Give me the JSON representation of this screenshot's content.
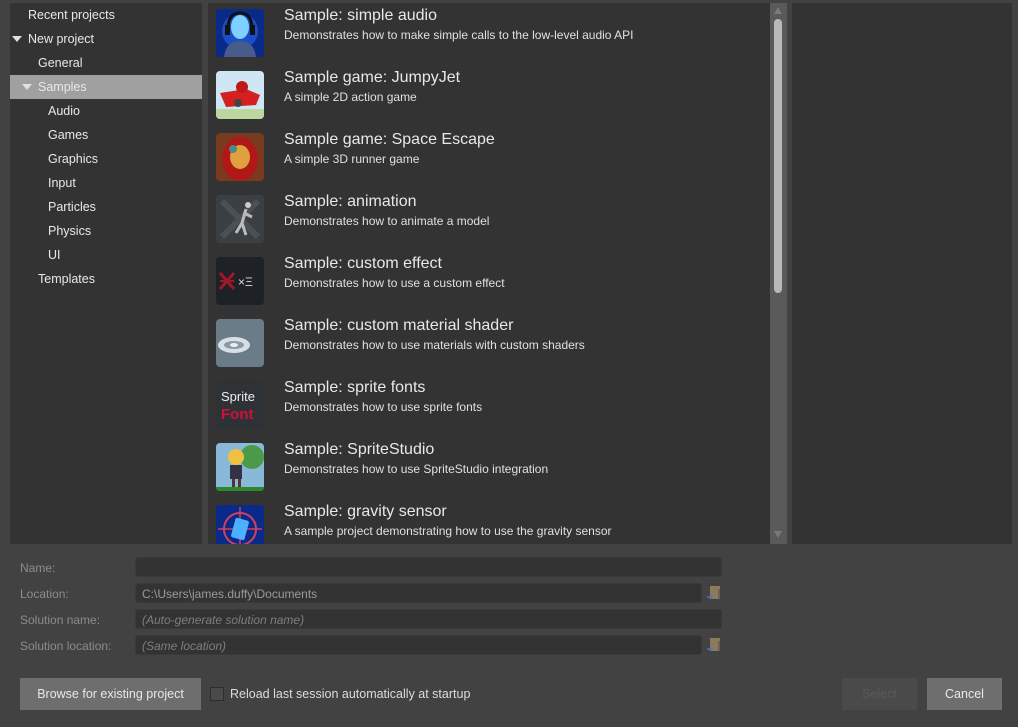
{
  "tree": {
    "items": [
      {
        "label": "Recent projects",
        "level": 0,
        "expandable": false,
        "selected": false
      },
      {
        "label": "New project",
        "level": 0,
        "expandable": true,
        "selected": false
      },
      {
        "label": "General",
        "level": 1,
        "expandable": false,
        "selected": false
      },
      {
        "label": "Samples",
        "level": 1,
        "expandable": true,
        "selected": true
      },
      {
        "label": "Audio",
        "level": 2,
        "expandable": false,
        "selected": false
      },
      {
        "label": "Games",
        "level": 2,
        "expandable": false,
        "selected": false
      },
      {
        "label": "Graphics",
        "level": 2,
        "expandable": false,
        "selected": false
      },
      {
        "label": "Input",
        "level": 2,
        "expandable": false,
        "selected": false
      },
      {
        "label": "Particles",
        "level": 2,
        "expandable": false,
        "selected": false
      },
      {
        "label": "Physics",
        "level": 2,
        "expandable": false,
        "selected": false
      },
      {
        "label": "UI",
        "level": 2,
        "expandable": false,
        "selected": false
      },
      {
        "label": "Templates",
        "level": 1,
        "expandable": false,
        "selected": false
      }
    ]
  },
  "samples": [
    {
      "title": "Sample: simple audio",
      "description": "Demonstrates how to make simple calls to the low-level audio API",
      "icon": "headphones-robot-icon"
    },
    {
      "title": "Sample game: JumpyJet",
      "description": "A simple 2D action game",
      "icon": "red-jet-icon"
    },
    {
      "title": "Sample game: Space Escape",
      "description": "A simple 3D runner game",
      "icon": "red-helmet-icon"
    },
    {
      "title": "Sample: animation",
      "description": "Demonstrates how to animate a model",
      "icon": "animated-model-icon"
    },
    {
      "title": "Sample: custom effect",
      "description": "Demonstrates how to use a custom effect",
      "icon": "xenko-logo-icon"
    },
    {
      "title": "Sample: custom material shader",
      "description": "Demonstrates how to use materials with custom shaders",
      "icon": "water-shader-icon"
    },
    {
      "title": "Sample: sprite fonts",
      "description": "Demonstrates how to use sprite fonts",
      "icon": "sprite-font-icon",
      "icon_text": [
        "Sprite",
        "Font"
      ]
    },
    {
      "title": "Sample: SpriteStudio",
      "description": "Demonstrates how to use SpriteStudio integration",
      "icon": "anime-character-icon"
    },
    {
      "title": "Sample: gravity sensor",
      "description": "A sample project demonstrating how to use the gravity sensor",
      "icon": "gravity-compass-icon"
    }
  ],
  "form": {
    "name_label": "Name:",
    "name_value": "",
    "location_label": "Location:",
    "location_value": "C:\\Users\\james.duffy\\Documents",
    "solution_name_label": "Solution name:",
    "solution_name_placeholder": "(Auto-generate solution name)",
    "solution_location_label": "Solution location:",
    "solution_location_placeholder": "(Same location)"
  },
  "footer": {
    "browse_label": "Browse for existing project",
    "reload_label": "Reload last session automatically at startup",
    "reload_checked": false,
    "select_label": "Select",
    "select_enabled": false,
    "cancel_label": "Cancel"
  },
  "colors": {
    "window_bg": "#424242",
    "panel_bg": "#333333",
    "selection_bg": "#a0a0a0",
    "button_bg": "#6e6e6e"
  }
}
